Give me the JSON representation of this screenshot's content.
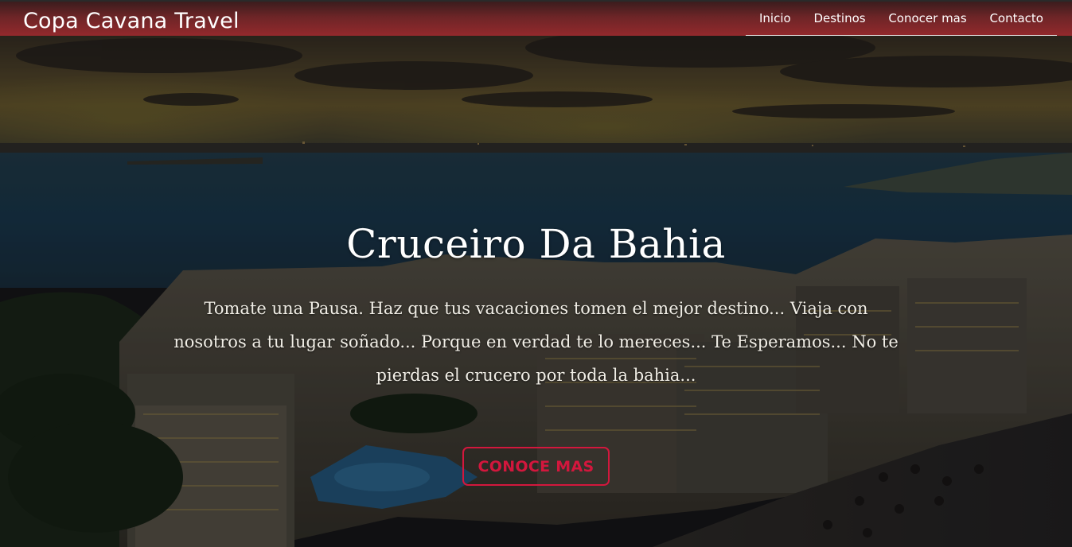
{
  "navbar": {
    "brand": "Copa Cavana Travel",
    "links": [
      {
        "label": "Inicio"
      },
      {
        "label": "Destinos"
      },
      {
        "label": "Conocer mas"
      },
      {
        "label": "Contacto"
      }
    ]
  },
  "hero": {
    "title": "Cruceiro Da Bahia",
    "description": "Tomate una Pausa. Haz que tus vacaciones tomen el mejor destino... Viaja con nosotros a tu lugar soñado... Porque en verdad te lo mereces... Te Esperamos... No te pierdas el crucero por toda la bahia...",
    "cta_label": "CONOCE MAS"
  },
  "colors": {
    "navbar": "#93292c",
    "cta_accent": "#d3173d",
    "text": "#ffffff"
  }
}
